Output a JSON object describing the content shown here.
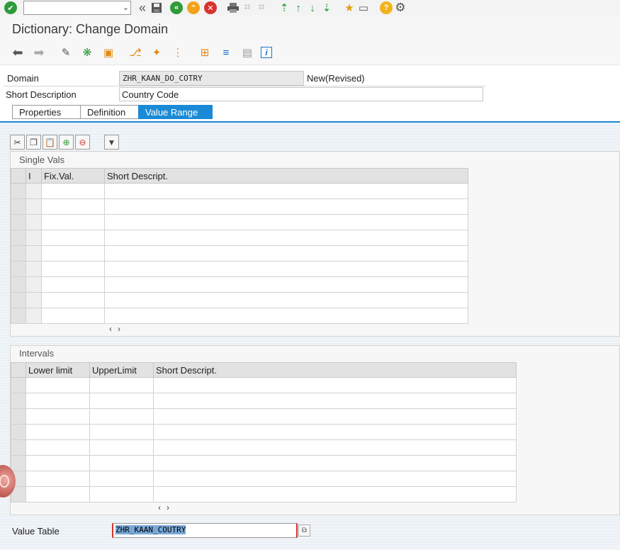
{
  "systoolbar": {
    "command_value": "",
    "icons": [
      "enter-icon",
      "back-nav-icon",
      "save-icon",
      "back-icon",
      "exit-icon",
      "cancel-icon",
      "print-icon",
      "find-icon",
      "find-next-icon",
      "first-page-icon",
      "prev-page-icon",
      "next-page-icon",
      "last-page-icon",
      "new-session-icon",
      "shortcut-icon",
      "help-icon",
      "settings-icon"
    ]
  },
  "title": "Dictionary: Change Domain",
  "fields": {
    "domain_label": "Domain",
    "domain_value": "ZHR_KAAN_DO_COTRY",
    "domain_status": "New(Revised)",
    "shortdesc_label": "Short Description",
    "shortdesc_value": "Country Code"
  },
  "tabs": [
    {
      "label": "Properties"
    },
    {
      "label": "Definition"
    },
    {
      "label": "Value Range",
      "active": true
    }
  ],
  "single_vals": {
    "title": "Single Vals",
    "columns": [
      "I",
      "Fix.Val.",
      "Short Descript."
    ],
    "rows": 9,
    "scroll_left": "‹",
    "scroll_right": "›"
  },
  "intervals": {
    "title": "Intervals",
    "columns": [
      "Lower limit",
      "UpperLimit",
      "Short Descript."
    ],
    "rows": 8,
    "scroll_left": "‹",
    "scroll_right": "›"
  },
  "value_table": {
    "label": "Value Table",
    "value": "ZHR_KAAN_COUTRY"
  },
  "colors": {
    "accent": "#1a8ad6",
    "enter_green": "#2e9b3a",
    "cancel_red": "#d8322f",
    "exit_orange": "#f2a31b"
  }
}
